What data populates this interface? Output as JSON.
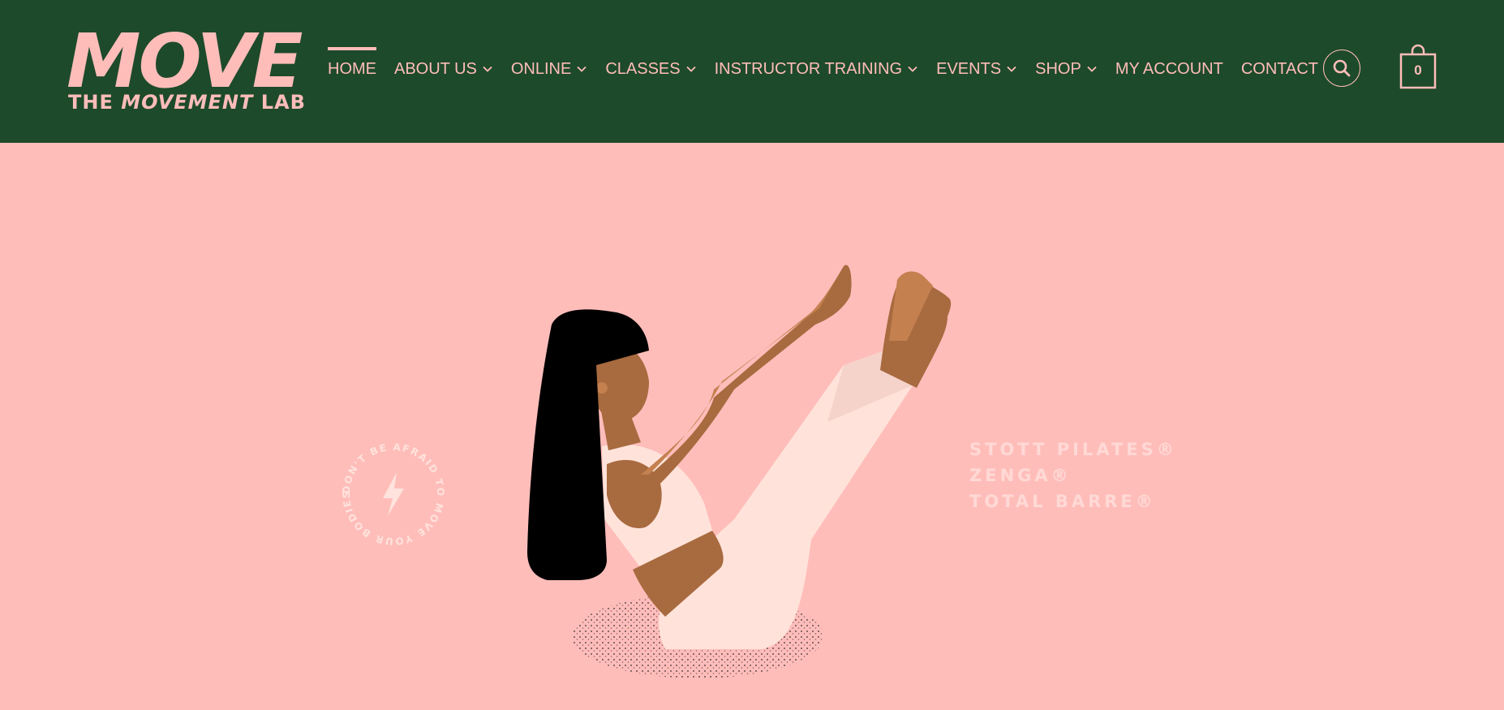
{
  "brand": {
    "name": "MOVE",
    "tagline_pre": "THE ",
    "tagline_em": "MOVEMENT",
    "tagline_post": " LAB"
  },
  "nav": {
    "items": [
      {
        "label": "HOME",
        "active": true,
        "dropdown": false
      },
      {
        "label": "ABOUT US",
        "dropdown": true
      },
      {
        "label": "ONLINE",
        "dropdown": true
      },
      {
        "label": "CLASSES",
        "dropdown": true
      },
      {
        "label": "INSTRUCTOR TRAINING",
        "dropdown": true
      },
      {
        "label": "EVENTS",
        "dropdown": true
      },
      {
        "label": "SHOP",
        "dropdown": true
      },
      {
        "label": "MY ACCOUNT",
        "dropdown": false
      },
      {
        "label": "CONTACT",
        "dropdown": false
      }
    ]
  },
  "header": {
    "search_icon": "search-icon",
    "cart_icon": "shopping-bag-icon",
    "cart_count": "0"
  },
  "hero": {
    "badge_text": "DON'T BE AFRAID TO MOVE YOUR BODIES.",
    "badge_icon": "lightning-bolt-icon",
    "disciplines": [
      "STOTT PILATES®",
      "ZENGA®",
      "TOTAL BARRE®"
    ]
  },
  "colors": {
    "header_bg": "#1d4a2a",
    "accent_pink": "#ffbdba",
    "skin": "#a86a3f",
    "hair": "#000000",
    "outfit": "#ffe3da"
  }
}
